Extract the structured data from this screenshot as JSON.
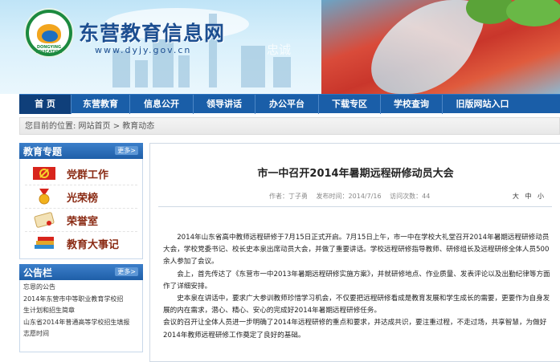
{
  "header": {
    "site_title": "东营教育信息网",
    "site_url": "www.dyjy.gov.cn",
    "logo_text": "DONGYING EDUCATION",
    "banner_faint_text": "忠诚"
  },
  "nav": {
    "items": [
      {
        "label": "首  页",
        "active": true
      },
      {
        "label": "东营教育",
        "active": false
      },
      {
        "label": "信息公开",
        "active": false
      },
      {
        "label": "领导讲话",
        "active": false
      },
      {
        "label": "办公平台",
        "active": false
      },
      {
        "label": "下载专区",
        "active": false
      },
      {
        "label": "学校查询",
        "active": false
      },
      {
        "label": "旧版网站入口",
        "active": false
      }
    ]
  },
  "breadcrumb": {
    "text": "您目前的位置: 网站首页 > 教育动态"
  },
  "sidebar": {
    "special_title": "教育专题",
    "more_label": "更多>",
    "special_items": [
      {
        "label": "党群工作",
        "icon": "party-emblem-icon"
      },
      {
        "label": "光荣榜",
        "icon": "medal-ribbon-icon"
      },
      {
        "label": "荣誉室",
        "icon": "scroll-certificate-icon"
      },
      {
        "label": "教育大事记",
        "icon": "books-icon"
      }
    ],
    "notice_title": "公告栏",
    "notice_items": [
      "忘恩的公告",
      "2014年东营市中等职业教育学校招",
      "生计划和招生简章",
      "山东省2014年普通高等学校招生填报",
      "志愿时间"
    ]
  },
  "article": {
    "title": "市一中召开2014年暑期远程研修动员大会",
    "author": "作者：丁子勇",
    "date": "发布时间：2014/7/16",
    "views": "访问次数：44",
    "font_sizes": [
      "大",
      "中",
      "小"
    ],
    "paragraphs": [
      "2014年山东省高中教师远程研修于7月15日正式开启。7月15日上午，市一中在学校大礼堂召开2014年暑期远程研修动员大会，学校党委书记、校长史本泉出席动员大会，并做了重要讲话。学校远程研修指导教师、研修组长及远程研修全体人员500余人参加了会议。",
      "会上，首先传达了《东营市一中2013年暑期远程研修实施方案》，并就研修地点、作业质量、发表评论以及出勤纪律等方面作了详细安排。",
      "史本泉在讲话中，要求广大参训教师珍惜学习机会，不仅要把远程研修看成是教育发展和学生成长的需要，更要作为自身发展的内在需求，潜心、精心、安心的完成好2014年暑期远程研修任务。",
      "会议的召开让全体人员进一步明确了2014年远程研修的重点和要求，并达成共识，要注重过程，不走过场，共享智慧，为做好2014年教师远程研修工作奠定了良好的基础。"
    ]
  }
}
